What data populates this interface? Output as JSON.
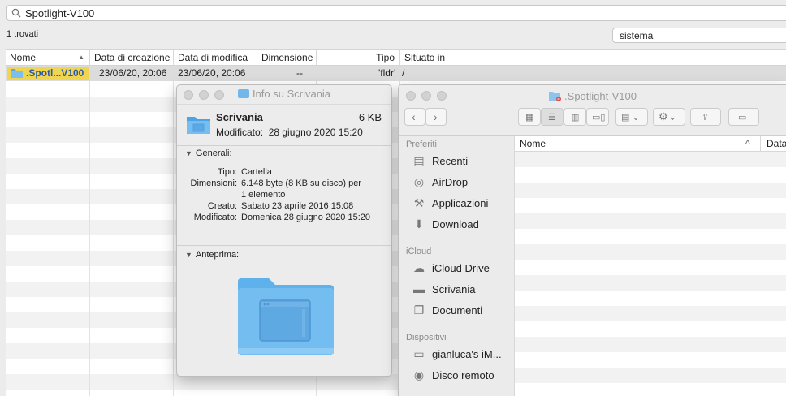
{
  "search": {
    "query": "Spotlight-V100"
  },
  "results": {
    "count_label": "1 trovati",
    "scope_value": "sistema"
  },
  "table": {
    "columns": [
      {
        "label": "Nome"
      },
      {
        "label": "Data di creazione"
      },
      {
        "label": "Data di modifica"
      },
      {
        "label": "Dimensione"
      },
      {
        "label": "Tipo"
      },
      {
        "label": "Situato in"
      }
    ],
    "sort_indicator": "▲",
    "rows": [
      {
        "name": ".Spotl...V100",
        "created": "23/06/20, 20:06",
        "modified": "23/06/20, 20:06",
        "size": "--",
        "kind": "'fldr'",
        "location": "/"
      }
    ]
  },
  "info_window": {
    "title": "Info su Scrivania",
    "name": "Scrivania",
    "size": "6 KB",
    "modified_label": "Modificato:",
    "modified_value": "28 giugno 2020 15:20",
    "general_label": "Generali:",
    "fields": [
      {
        "key": "Tipo:",
        "value": "Cartella"
      },
      {
        "key": "Dimensioni:",
        "value": "6.148 byte (8 KB su disco) per"
      },
      {
        "key": "",
        "value": "1 elemento"
      },
      {
        "key": "Creato:",
        "value": "Sabato 23 aprile 2016 15:08"
      },
      {
        "key": "Modificato:",
        "value": "Domenica 28 giugno 2020 15:20"
      }
    ],
    "preview_label": "Anteprima:",
    "folder_color": "#6cb8ec"
  },
  "finder": {
    "title": ".Spotlight-V100",
    "sidebar": {
      "favorites_label": "Preferiti",
      "favorites": [
        {
          "label": "Recenti",
          "icon": "clock-icon"
        },
        {
          "label": "AirDrop",
          "icon": "airdrop-icon"
        },
        {
          "label": "Applicazioni",
          "icon": "applications-icon"
        },
        {
          "label": "Download",
          "icon": "download-icon"
        }
      ],
      "icloud_label": "iCloud",
      "icloud": [
        {
          "label": "iCloud Drive",
          "icon": "cloud-icon"
        },
        {
          "label": "Scrivania",
          "icon": "desktop-icon"
        },
        {
          "label": "Documenti",
          "icon": "documents-icon"
        }
      ],
      "devices_label": "Dispositivi",
      "devices": [
        {
          "label": "gianluca's iM...",
          "icon": "imac-icon"
        },
        {
          "label": "Disco remoto",
          "icon": "disc-icon"
        }
      ]
    },
    "list_columns": [
      "Nome",
      "Data"
    ],
    "sort_indicator": "^"
  },
  "colors": {
    "selection": "#f0d650",
    "folder": "#6cb8ec",
    "accent": "#3478f6"
  }
}
